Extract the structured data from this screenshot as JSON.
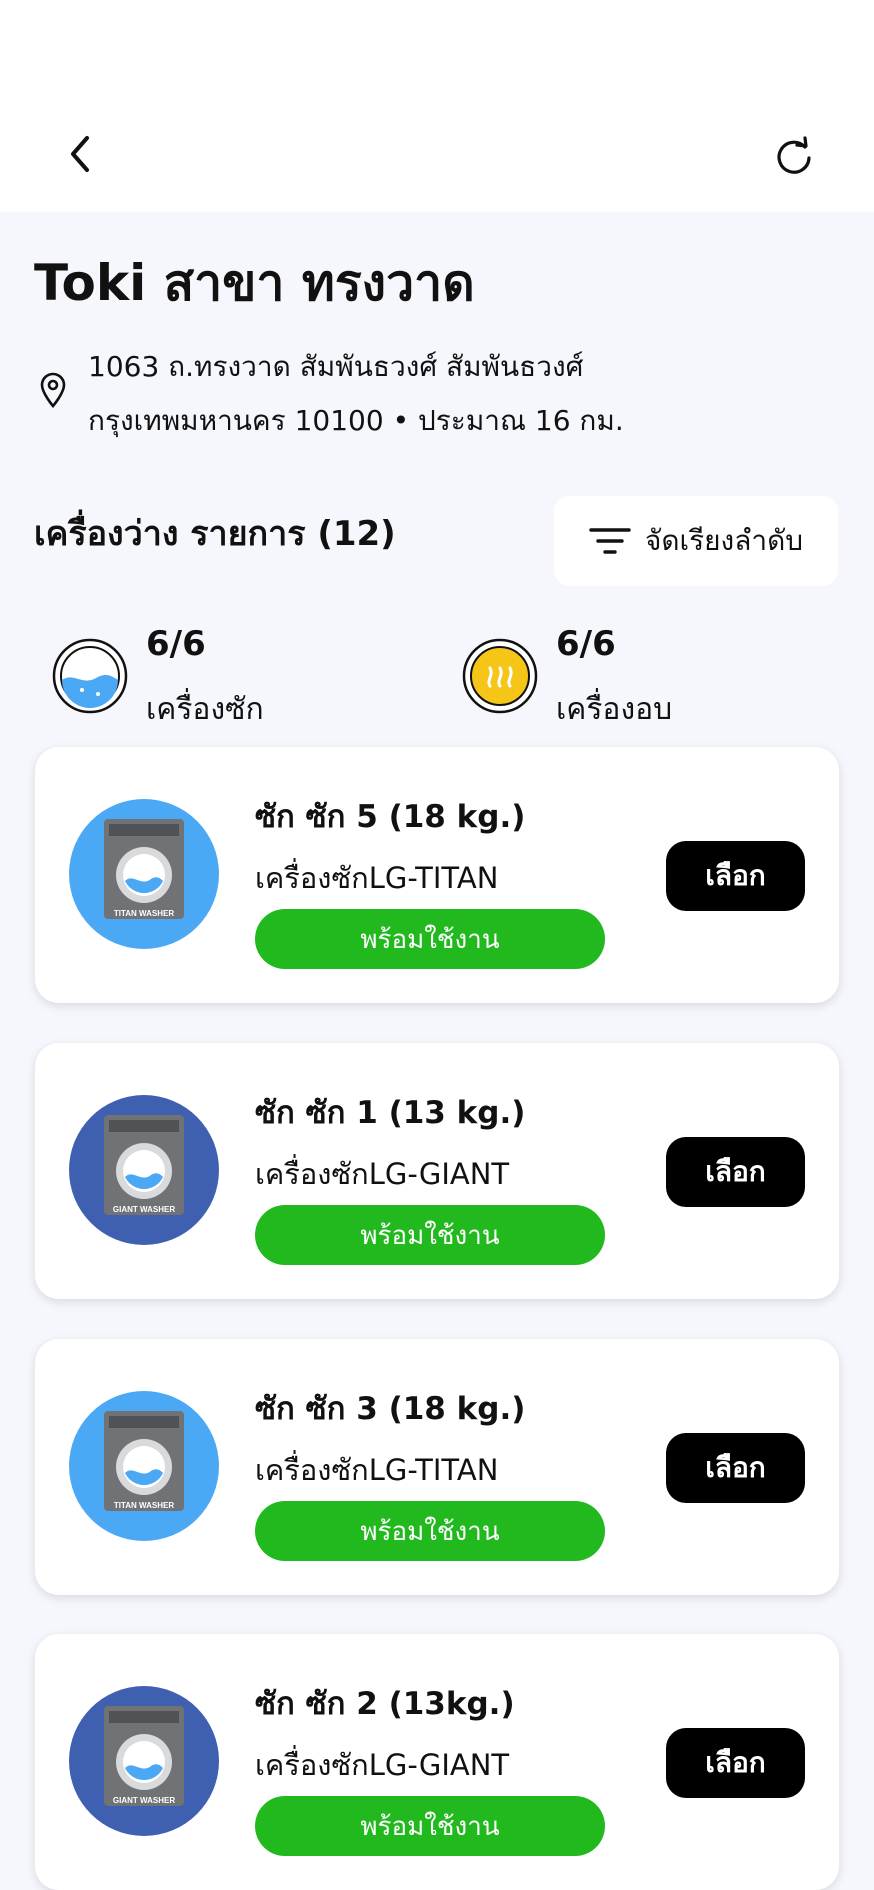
{
  "header": {
    "back_icon": "chevron-left-icon",
    "refresh_icon": "refresh-icon"
  },
  "branch": {
    "title": "Toki สาขา ทรงวาด",
    "address_line1": "1063 ถ.ทรงวาด สัมพันธวงศ์ สัมพันธวงศ์",
    "address_line2": "กรุงเทพมหานคร 10100 • ประมาณ 16 กม."
  },
  "list": {
    "title": "เครื่องว่าง รายการ (12)",
    "sort_label": "จัดเรียงลำดับ"
  },
  "stats": {
    "washer": {
      "count": "6/6",
      "label": "เครื่องซัก"
    },
    "dryer": {
      "count": "6/6",
      "label": "เครื่องอบ"
    }
  },
  "machines": [
    {
      "name": "ซัก ซัก 5  (18 kg.)",
      "model": "เครื่องซักLG-TITAN",
      "status": "พร้อมใช้งาน",
      "button": "เลือก",
      "badge": "TITAN WASHER"
    },
    {
      "name": "ซัก ซัก 1 (13 kg.)",
      "model": "เครื่องซักLG-GIANT",
      "status": "พร้อมใช้งาน",
      "button": "เลือก",
      "badge": "GIANT WASHER"
    },
    {
      "name": "ซัก ซัก 3 (18 kg.)",
      "model": "เครื่องซักLG-TITAN",
      "status": "พร้อมใช้งาน",
      "button": "เลือก",
      "badge": "TITAN WASHER"
    },
    {
      "name": "ซัก ซัก 2 (13kg.)",
      "model": "เครื่องซักLG-GIANT",
      "status": "พร้อมใช้งาน",
      "button": "เลือก",
      "badge": "GIANT WASHER"
    }
  ],
  "colors": {
    "status_green": "#22b91f",
    "select_black": "#000000",
    "titan_blue": "#4aa8f5",
    "giant_blue": "#3f5fb0",
    "dryer_yellow": "#f5c518"
  }
}
